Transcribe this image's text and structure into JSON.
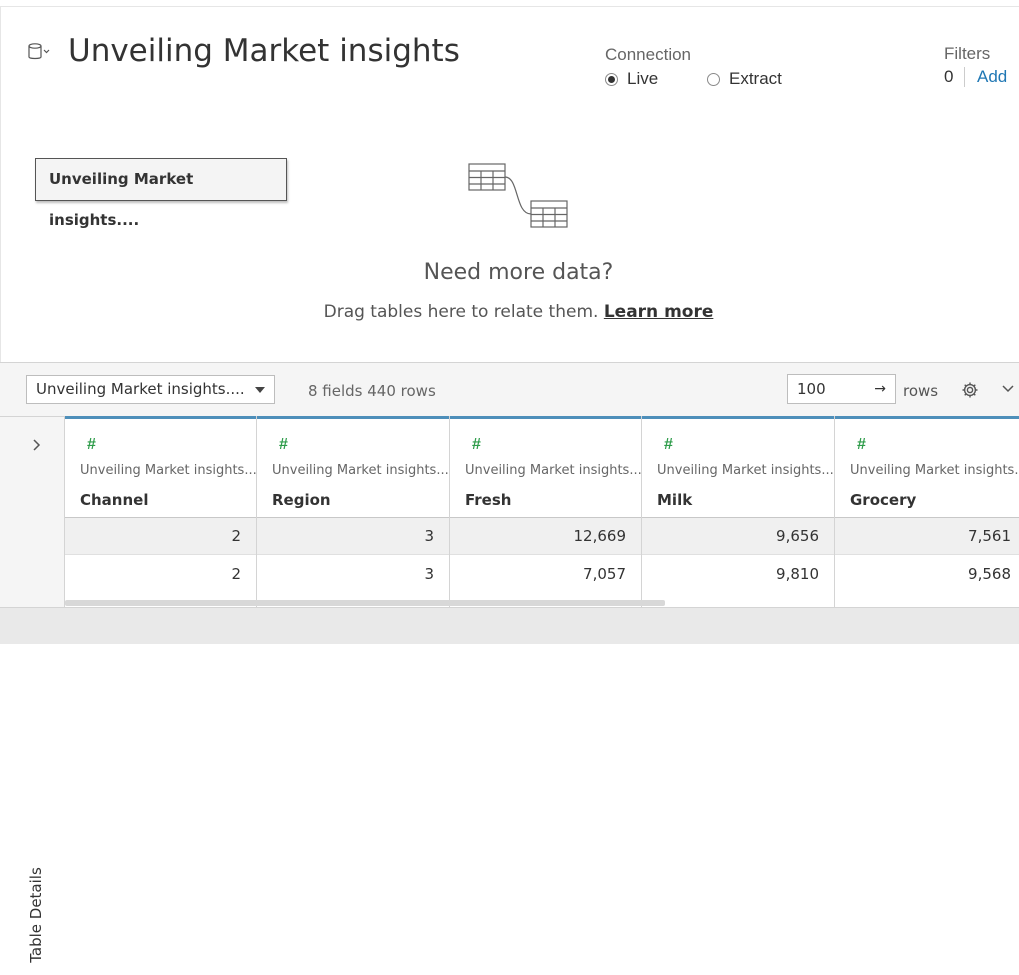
{
  "header": {
    "title": "Unveiling Market insights",
    "connection_label": "Connection",
    "connection_options": [
      "Live",
      "Extract"
    ],
    "connection_selected": "Live",
    "filters_label": "Filters",
    "filters_count": "0",
    "filters_add": "Add"
  },
  "canvas": {
    "table_pill": "Unveiling Market insights....",
    "need_more": "Need more data?",
    "drag_text": "Drag tables here to relate them.",
    "learn_more": "Learn more"
  },
  "toolbar": {
    "table_select": "Unveiling Market insights....",
    "fields_info": "8 fields 440 rows",
    "rows_value": "100",
    "rows_label": "rows"
  },
  "side": {
    "label": "Table Details"
  },
  "grid": {
    "columns": [
      {
        "source": "Unveiling Market insights....",
        "name": "Channel"
      },
      {
        "source": "Unveiling Market insights....",
        "name": "Region"
      },
      {
        "source": "Unveiling Market insights....",
        "name": "Fresh"
      },
      {
        "source": "Unveiling Market insights....",
        "name": "Milk"
      },
      {
        "source": "Unveiling Market insights....",
        "name": "Grocery"
      }
    ],
    "rows": [
      [
        "2",
        "3",
        "12,669",
        "9,656",
        "7,561"
      ],
      [
        "2",
        "3",
        "7,057",
        "9,810",
        "9,568"
      ]
    ]
  }
}
